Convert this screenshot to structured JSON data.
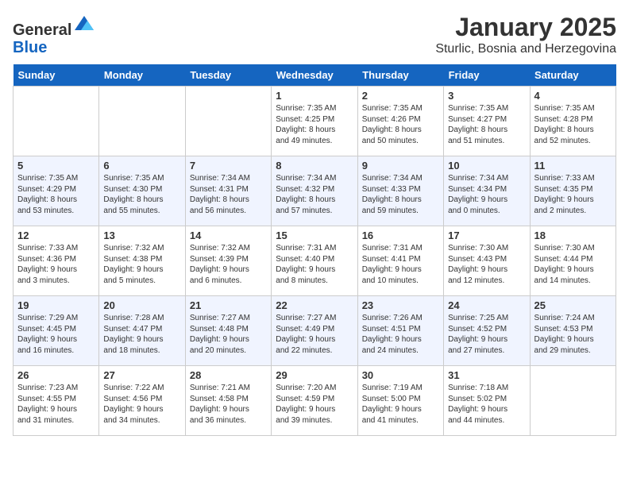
{
  "logo": {
    "general": "General",
    "blue": "Blue"
  },
  "header": {
    "title": "January 2025",
    "subtitle": "Sturlic, Bosnia and Herzegovina"
  },
  "days_of_week": [
    "Sunday",
    "Monday",
    "Tuesday",
    "Wednesday",
    "Thursday",
    "Friday",
    "Saturday"
  ],
  "weeks": [
    [
      {
        "day": "",
        "info": ""
      },
      {
        "day": "",
        "info": ""
      },
      {
        "day": "",
        "info": ""
      },
      {
        "day": "1",
        "info": "Sunrise: 7:35 AM\nSunset: 4:25 PM\nDaylight: 8 hours\nand 49 minutes."
      },
      {
        "day": "2",
        "info": "Sunrise: 7:35 AM\nSunset: 4:26 PM\nDaylight: 8 hours\nand 50 minutes."
      },
      {
        "day": "3",
        "info": "Sunrise: 7:35 AM\nSunset: 4:27 PM\nDaylight: 8 hours\nand 51 minutes."
      },
      {
        "day": "4",
        "info": "Sunrise: 7:35 AM\nSunset: 4:28 PM\nDaylight: 8 hours\nand 52 minutes."
      }
    ],
    [
      {
        "day": "5",
        "info": "Sunrise: 7:35 AM\nSunset: 4:29 PM\nDaylight: 8 hours\nand 53 minutes."
      },
      {
        "day": "6",
        "info": "Sunrise: 7:35 AM\nSunset: 4:30 PM\nDaylight: 8 hours\nand 55 minutes."
      },
      {
        "day": "7",
        "info": "Sunrise: 7:34 AM\nSunset: 4:31 PM\nDaylight: 8 hours\nand 56 minutes."
      },
      {
        "day": "8",
        "info": "Sunrise: 7:34 AM\nSunset: 4:32 PM\nDaylight: 8 hours\nand 57 minutes."
      },
      {
        "day": "9",
        "info": "Sunrise: 7:34 AM\nSunset: 4:33 PM\nDaylight: 8 hours\nand 59 minutes."
      },
      {
        "day": "10",
        "info": "Sunrise: 7:34 AM\nSunset: 4:34 PM\nDaylight: 9 hours\nand 0 minutes."
      },
      {
        "day": "11",
        "info": "Sunrise: 7:33 AM\nSunset: 4:35 PM\nDaylight: 9 hours\nand 2 minutes."
      }
    ],
    [
      {
        "day": "12",
        "info": "Sunrise: 7:33 AM\nSunset: 4:36 PM\nDaylight: 9 hours\nand 3 minutes."
      },
      {
        "day": "13",
        "info": "Sunrise: 7:32 AM\nSunset: 4:38 PM\nDaylight: 9 hours\nand 5 minutes."
      },
      {
        "day": "14",
        "info": "Sunrise: 7:32 AM\nSunset: 4:39 PM\nDaylight: 9 hours\nand 6 minutes."
      },
      {
        "day": "15",
        "info": "Sunrise: 7:31 AM\nSunset: 4:40 PM\nDaylight: 9 hours\nand 8 minutes."
      },
      {
        "day": "16",
        "info": "Sunrise: 7:31 AM\nSunset: 4:41 PM\nDaylight: 9 hours\nand 10 minutes."
      },
      {
        "day": "17",
        "info": "Sunrise: 7:30 AM\nSunset: 4:43 PM\nDaylight: 9 hours\nand 12 minutes."
      },
      {
        "day": "18",
        "info": "Sunrise: 7:30 AM\nSunset: 4:44 PM\nDaylight: 9 hours\nand 14 minutes."
      }
    ],
    [
      {
        "day": "19",
        "info": "Sunrise: 7:29 AM\nSunset: 4:45 PM\nDaylight: 9 hours\nand 16 minutes."
      },
      {
        "day": "20",
        "info": "Sunrise: 7:28 AM\nSunset: 4:47 PM\nDaylight: 9 hours\nand 18 minutes."
      },
      {
        "day": "21",
        "info": "Sunrise: 7:27 AM\nSunset: 4:48 PM\nDaylight: 9 hours\nand 20 minutes."
      },
      {
        "day": "22",
        "info": "Sunrise: 7:27 AM\nSunset: 4:49 PM\nDaylight: 9 hours\nand 22 minutes."
      },
      {
        "day": "23",
        "info": "Sunrise: 7:26 AM\nSunset: 4:51 PM\nDaylight: 9 hours\nand 24 minutes."
      },
      {
        "day": "24",
        "info": "Sunrise: 7:25 AM\nSunset: 4:52 PM\nDaylight: 9 hours\nand 27 minutes."
      },
      {
        "day": "25",
        "info": "Sunrise: 7:24 AM\nSunset: 4:53 PM\nDaylight: 9 hours\nand 29 minutes."
      }
    ],
    [
      {
        "day": "26",
        "info": "Sunrise: 7:23 AM\nSunset: 4:55 PM\nDaylight: 9 hours\nand 31 minutes."
      },
      {
        "day": "27",
        "info": "Sunrise: 7:22 AM\nSunset: 4:56 PM\nDaylight: 9 hours\nand 34 minutes."
      },
      {
        "day": "28",
        "info": "Sunrise: 7:21 AM\nSunset: 4:58 PM\nDaylight: 9 hours\nand 36 minutes."
      },
      {
        "day": "29",
        "info": "Sunrise: 7:20 AM\nSunset: 4:59 PM\nDaylight: 9 hours\nand 39 minutes."
      },
      {
        "day": "30",
        "info": "Sunrise: 7:19 AM\nSunset: 5:00 PM\nDaylight: 9 hours\nand 41 minutes."
      },
      {
        "day": "31",
        "info": "Sunrise: 7:18 AM\nSunset: 5:02 PM\nDaylight: 9 hours\nand 44 minutes."
      },
      {
        "day": "",
        "info": ""
      }
    ]
  ]
}
